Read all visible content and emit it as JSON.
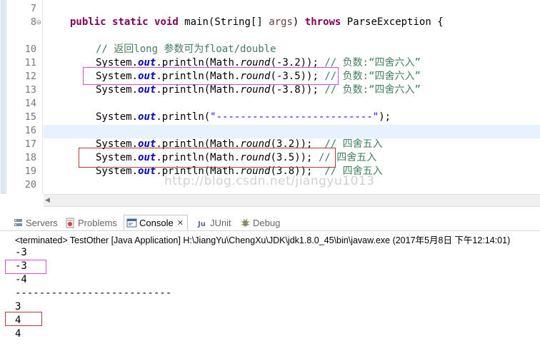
{
  "editor": {
    "line_numbers": [
      "7",
      "8",
      "10",
      "11",
      "12",
      "13",
      "14",
      "15",
      "16",
      "17",
      "18",
      "19",
      "20"
    ],
    "line8": {
      "kw_public": "public",
      "kw_static": "static",
      "kw_void": "void",
      "method": " main(String[] ",
      "param": "args",
      "close": ") ",
      "kw_throws": "throws",
      "tail": " ParseException {"
    },
    "comment10": "// 返回long 参数可为float/double",
    "calls": {
      "prefix": "System.",
      "out": "out",
      "println_open": ".println(Math.",
      "round": "round",
      "arg_neg32": "(-3.2));",
      "arg_neg35": "(-3.5));",
      "arg_neg38": "(-3.8));",
      "arg_32": "(3.2));",
      "arg_35": "(3.5));",
      "arg_38": "(3.8));",
      "println_str_open": ".println(",
      "separator_string": "\"--------------------------\"",
      "println_str_close": ");"
    },
    "comment_neg": "// 负数:“四舍六入”",
    "comment_pos": "// 四舍五入",
    "watermark": "http://blog.csdn.net/jiangyu1013"
  },
  "console": {
    "tabs": [
      {
        "label": "Servers",
        "icon": "servers-icon"
      },
      {
        "label": "Problems",
        "icon": "problems-icon"
      },
      {
        "label": "Console",
        "icon": "console-icon"
      },
      {
        "label": "JUnit",
        "icon": "junit-icon"
      },
      {
        "label": "Debug",
        "icon": "debug-icon"
      }
    ],
    "close_glyph": "✕",
    "status": "<terminated> TestOther [Java Application] H:\\JiangYu\\ChengXu\\JDK\\jdk1.8.0_45\\bin\\javaw.exe (2017年5月8日 下午12:14:01)",
    "output": [
      "-3",
      "-3",
      "-4",
      "--------------------------",
      "3",
      "4",
      "4"
    ]
  },
  "colors": {
    "keyword": "#7f0055",
    "field": "#0000c0",
    "string": "#2a00ff",
    "comment": "#3f7f5f",
    "highlight_magenta": "#d94bd4",
    "highlight_red": "#b03a3a"
  }
}
